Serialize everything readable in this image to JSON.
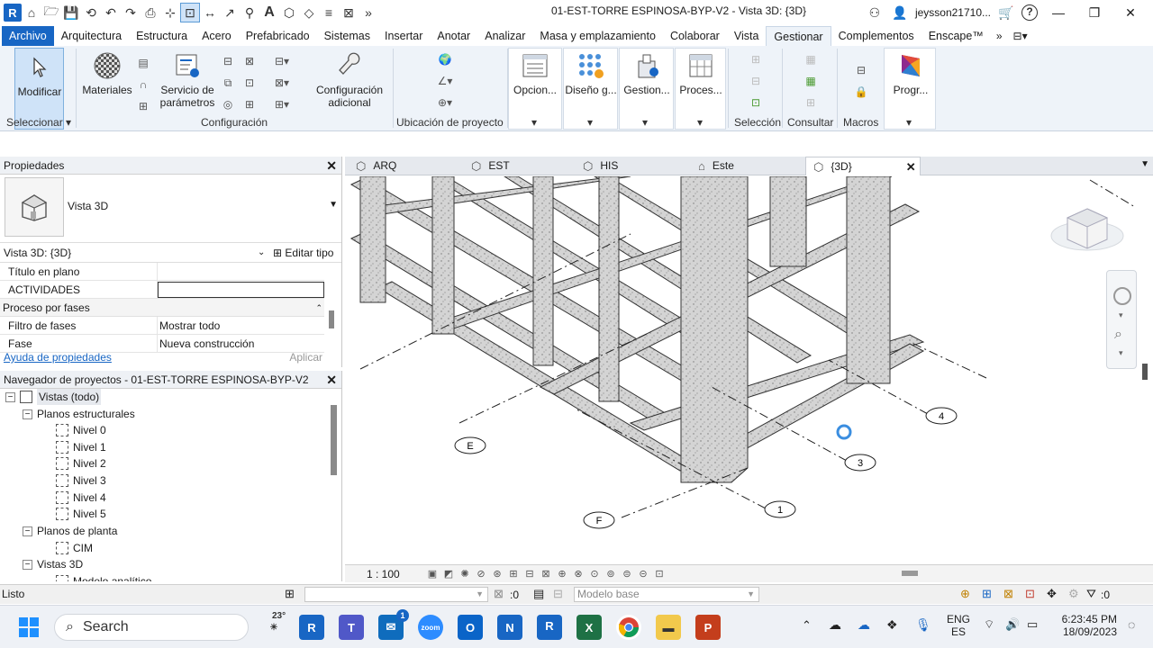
{
  "title_bar": {
    "title": "01-EST-TORRE ESPINOSA-BYP-V2 - Vista 3D: {3D}",
    "user": "jeysson21710...",
    "help": "?"
  },
  "ribbon_tabs": [
    "Archivo",
    "Arquitectura",
    "Estructura",
    "Acero",
    "Prefabricado",
    "Sistemas",
    "Insertar",
    "Anotar",
    "Analizar",
    "Masa y emplazamiento",
    "Colaborar",
    "Vista",
    "Gestionar",
    "Complementos",
    "Enscape™"
  ],
  "ribbon_selected": "Gestionar",
  "ribbon": {
    "modificar": "Modificar",
    "seleccionar": "Seleccionar",
    "materiales": "Materiales",
    "servicio_line1": "Servicio de",
    "servicio_line2": "parámetros",
    "config_line1": "Configuración",
    "config_line2": "adicional",
    "configuracion_panel": "Configuración",
    "ubicacion_panel": "Ubicación de proyecto",
    "opciones": "Opcion...",
    "diseno": "Diseño g...",
    "gestion": "Gestion...",
    "proceso": "Proces...",
    "seleccion_panel": "Selección",
    "consultar_panel": "Consultar",
    "macros_panel": "Macros",
    "programa": "Progr..."
  },
  "properties": {
    "header": "Propiedades",
    "type_name": "Vista 3D",
    "filter": "Vista 3D: {3D}",
    "edit_type": "Editar tipo",
    "rows": [
      {
        "key": "Título en plano",
        "value": ""
      },
      {
        "key": "ACTIVIDADES",
        "value": ""
      }
    ],
    "group": "Proceso por fases",
    "group_rows": [
      {
        "key": "Filtro de fases",
        "value": "Mostrar todo"
      },
      {
        "key": "Fase",
        "value": "Nueva construcción"
      }
    ],
    "help_link": "Ayuda de propiedades",
    "apply": "Aplicar"
  },
  "browser": {
    "header": "Navegador de proyectos - 01-EST-TORRE ESPINOSA-BYP-V2",
    "root": "Vistas (todo)",
    "structural_plans": "Planos estructurales",
    "levels": [
      "Nivel 0",
      "Nivel 1",
      "Nivel 2",
      "Nivel 3",
      "Nivel 4",
      "Nivel 5"
    ],
    "floor_plans": "Planos de planta",
    "floor_items": [
      "CIM"
    ],
    "views_3d": "Vistas 3D",
    "views_3d_partial": "Modelo analítico"
  },
  "view_tabs": [
    {
      "label": "ARQ",
      "icon": "3d-view-icon"
    },
    {
      "label": "EST",
      "icon": "3d-view-icon"
    },
    {
      "label": "HIS",
      "icon": "3d-view-icon"
    },
    {
      "label": "Este",
      "icon": "elevation-icon"
    },
    {
      "label": "{3D}",
      "icon": "3d-view-icon",
      "active": true
    }
  ],
  "grid_bubbles": [
    "E",
    "F",
    "1",
    "3",
    "4"
  ],
  "viewbar": {
    "scale": "1 : 100"
  },
  "status": {
    "text": "Listo",
    "count": ":0",
    "model": "Modelo base",
    "filter_count": ":0"
  },
  "taskbar": {
    "search": "Search",
    "weather": "23°",
    "mail_badge": "1",
    "lang1": "ENG",
    "lang2": "ES",
    "time": "6:23:45 PM",
    "date": "18/09/2023"
  },
  "colors": {
    "accent": "#1866c4",
    "ribbon_bg": "#eef3f9",
    "concrete": "#cfcfcf"
  }
}
